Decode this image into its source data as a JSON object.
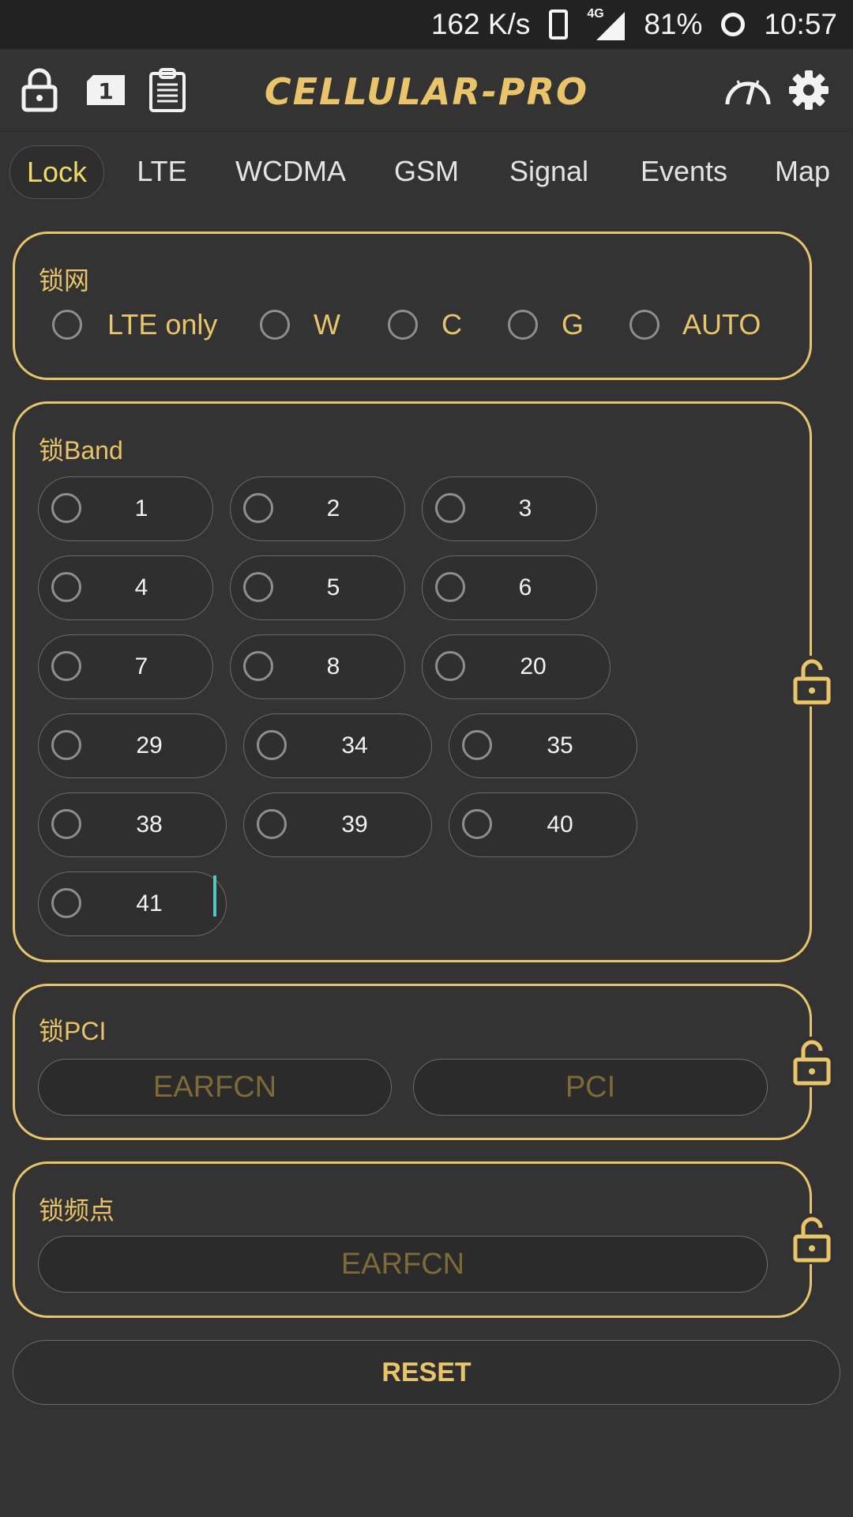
{
  "status_bar": {
    "net_speed": "162 K/s",
    "network_type": "4G",
    "battery": "81%",
    "time": "10:57"
  },
  "toolbar": {
    "app_title": "Cellular-Pro",
    "icons": [
      "lock-icon",
      "sim-icon",
      "clipboard-icon",
      "speedometer-icon",
      "gear-icon"
    ],
    "sim_number": "1"
  },
  "tabs": [
    {
      "label": "Lock",
      "active": true
    },
    {
      "label": "LTE",
      "active": false
    },
    {
      "label": "WCDMA",
      "active": false
    },
    {
      "label": "GSM",
      "active": false
    },
    {
      "label": "Signal",
      "active": false
    },
    {
      "label": "Events",
      "active": false
    },
    {
      "label": "Map",
      "active": false
    }
  ],
  "lock_network": {
    "title": "锁网",
    "options": [
      "LTE only",
      "W",
      "C",
      "G",
      "AUTO"
    ]
  },
  "lock_band": {
    "title": "锁Band",
    "bands": [
      "1",
      "2",
      "3",
      "4",
      "5",
      "6",
      "7",
      "8",
      "20",
      "29",
      "34",
      "35",
      "38",
      "39",
      "40",
      "41"
    ]
  },
  "lock_pci": {
    "title": "锁PCI",
    "earfcn_placeholder": "EARFCN",
    "pci_placeholder": "PCI"
  },
  "lock_freq": {
    "title": "锁频点",
    "earfcn_placeholder": "EARFCN"
  },
  "reset_label": "RESET",
  "colors": {
    "accent": "#e9c46a",
    "background": "#333333",
    "status_bar": "#222222",
    "active_tab_text": "#f0d96b",
    "caret": "#54c6c2"
  }
}
